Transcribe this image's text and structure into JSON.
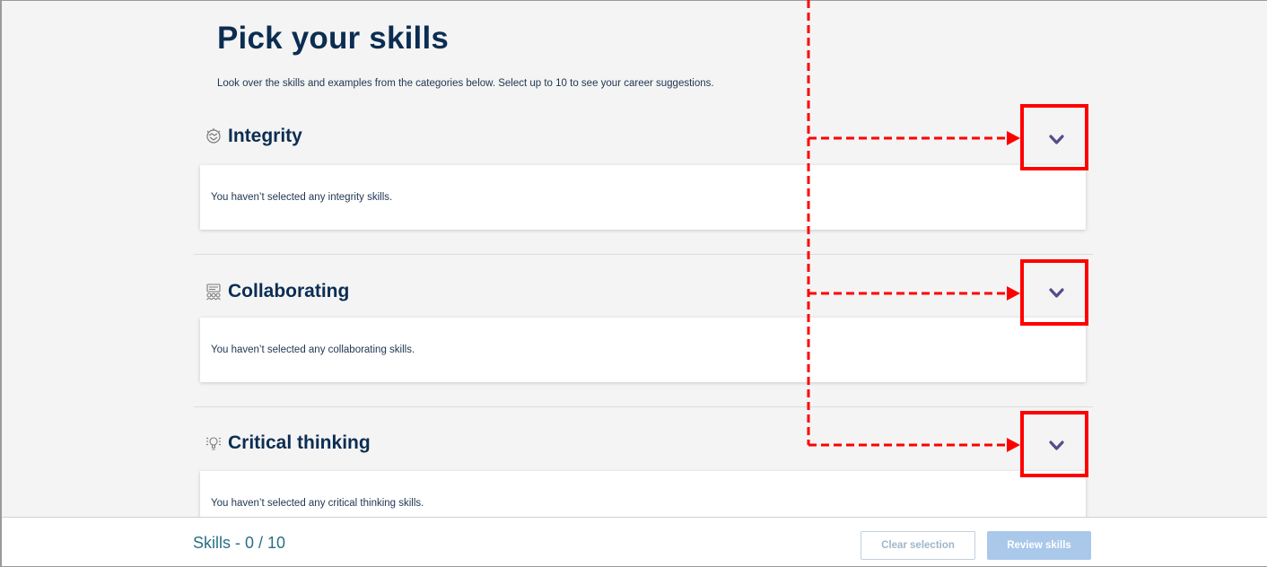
{
  "header": {
    "title": "Pick your skills",
    "intro": "Look over the skills and examples from the categories below. Select up to 10 to see your career suggestions."
  },
  "sections": [
    {
      "title": "Integrity",
      "icon": "handshake-icon",
      "empty_text": "You haven’t selected any integrity skills.",
      "expand_icon": "chevron-down-icon"
    },
    {
      "title": "Collaborating",
      "icon": "team-icon",
      "empty_text": "You haven’t selected any collaborating skills.",
      "expand_icon": "chevron-down-icon"
    },
    {
      "title": "Critical thinking",
      "icon": "lightbulb-icon",
      "empty_text": "You haven’t selected any critical thinking skills.",
      "expand_icon": "chevron-down-icon"
    }
  ],
  "footer": {
    "count_label": "Skills - 0 / 10",
    "clear_label": "Clear selection",
    "review_label": "Review skills"
  },
  "colors": {
    "heading": "#0b2d52",
    "chevron": "#5a4a8a",
    "annotation": "#ff0000",
    "review_button_disabled": "#a9c8ea",
    "count_text": "#2a6f86"
  }
}
